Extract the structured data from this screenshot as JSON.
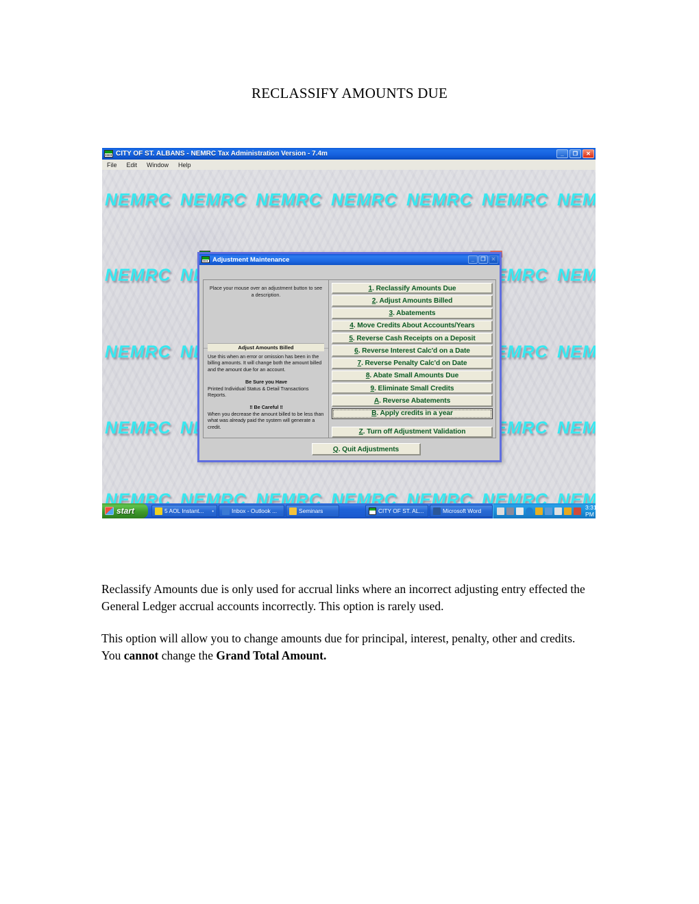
{
  "document": {
    "title": "RECLASSIFY AMOUNTS DUE",
    "paragraph1": "Reclassify Amounts due is only used for accrual links where an incorrect adjusting entry effected the General Ledger accrual accounts incorrectly.    This option is rarely used.",
    "paragraph2_part1": "This option will allow you to change amounts due for principal, interest, penalty, other and credits.  You ",
    "paragraph2_bold1": "cannot",
    "paragraph2_part2": " change the ",
    "paragraph2_bold2": "Grand Total Amount."
  },
  "screenshot": {
    "app_window": {
      "title": "CITY OF ST. ALBANS - NEMRC Tax Administration Version - 7.4m",
      "menu": [
        "File",
        "Edit",
        "Window",
        "Help"
      ],
      "minimize_label": "_",
      "restore_label": "❐",
      "close_label": "✕"
    },
    "desktop": {
      "watermark_text": "NEMRC",
      "watermark_color": "#36e8f0",
      "watermark_repeat": 7,
      "watermark_rows": 5
    },
    "dialog": {
      "title": "Adjustment Maintenance",
      "minimize_label": "_",
      "restore_label": "❐",
      "close_label": "✕",
      "hint": "Place your mouse over an adjustment button to see a description.",
      "description": {
        "heading": "Adjust Amounts Billed",
        "body": "Use this when an error or omission has been in the billing amounts.  It will change both the amount billed and the amount due for an account.",
        "be_sure_heading": "Be Sure you Have",
        "be_sure_body": "Printed Individual Status & Detail Transactions Reports.",
        "careful_heading": "‼ Be Careful ‼",
        "careful_body": "When you decrease the amount billed to be less than what was already paid the system will generate a credit."
      },
      "buttons": [
        {
          "key": "1",
          "label": "1.  Reclassify Amounts Due"
        },
        {
          "key": "2",
          "label": "2. Adjust Amounts Billed"
        },
        {
          "key": "3",
          "label": "3. Abatements"
        },
        {
          "key": "4",
          "label": "4. Move Credits About Accounts/Years"
        },
        {
          "key": "5",
          "label": "5. Reverse Cash Receipts on a Deposit"
        },
        {
          "key": "6",
          "label": "6. Reverse Interest Calc'd on a Date"
        },
        {
          "key": "7",
          "label": "7. Reverse Penalty Calc'd on Date"
        },
        {
          "key": "8",
          "label": "8. Abate Small Amounts Due"
        },
        {
          "key": "9",
          "label": "9. Eliminate Small Credits"
        },
        {
          "key": "A",
          "label": "A. Reverse Abatements"
        },
        {
          "key": "B",
          "label": "B. Apply credits in a year"
        }
      ],
      "validation_button": {
        "key": "Z",
        "label": "Z. Turn off Adjustment Validation"
      },
      "quit_button": {
        "key": "Q",
        "label": "Q.  Quit Adjustments"
      }
    },
    "taskbar": {
      "start_label": "start",
      "tasks": [
        {
          "label": "5 AOL Instant...",
          "icon": "aim-icon",
          "color": "#f0d020",
          "group": true
        },
        {
          "label": "Inbox - Outlook ...",
          "icon": "outlook-icon",
          "color": "#3a7ad4",
          "group": false
        },
        {
          "label": "Seminars",
          "icon": "folder-icon",
          "color": "#f5c23a",
          "group": false
        },
        {
          "label": "CITY OF ST. AL...",
          "icon": "nemrc-icon",
          "color": "#17a020",
          "group": false
        },
        {
          "label": "Microsoft Word",
          "icon": "word-icon",
          "color": "#2b5797",
          "group": false
        }
      ],
      "tray_icons": [
        "pen-icon",
        "monitor-icon",
        "help-icon",
        "chevron-left-icon",
        "network-icon",
        "sync-icon",
        "battery-icon",
        "messenger-icon",
        "update-icon"
      ],
      "clock": "3:31 PM"
    }
  }
}
